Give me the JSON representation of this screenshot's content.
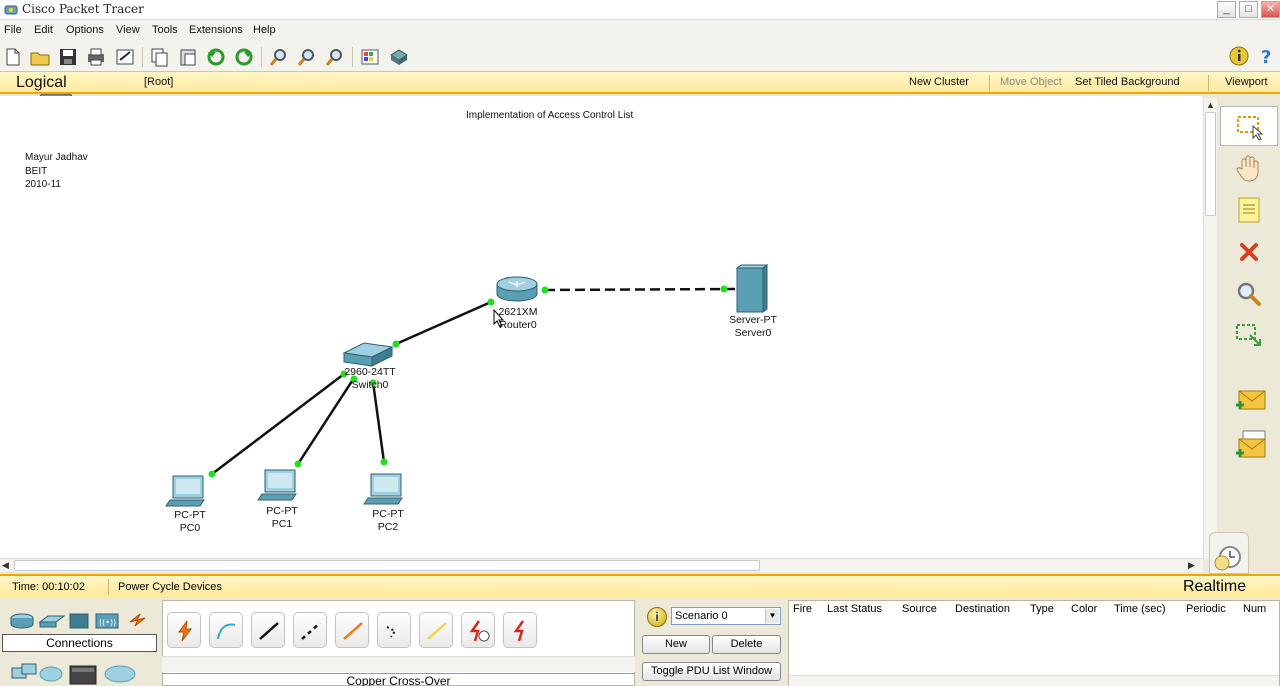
{
  "window": {
    "title": "Cisco Packet Tracer",
    "controls": [
      "_",
      "□",
      "✕"
    ]
  },
  "menu": [
    "File",
    "Edit",
    "Options",
    "View",
    "Tools",
    "Extensions",
    "Help"
  ],
  "nav": {
    "mode": "Logical",
    "root": "[Root]",
    "new_cluster": "New Cluster",
    "move_object": "Move Object",
    "set_tiled_background": "Set Tiled Background",
    "viewport": "Viewport"
  },
  "workspace": {
    "note_title": "Implementation of Access Control List",
    "author_lines": [
      "Mayur Jadhav",
      "BEIT",
      "2010-11"
    ],
    "devices": {
      "router": {
        "model": "2621XM",
        "name": "Router0"
      },
      "switch": {
        "model": "2960-24TT",
        "name": "Switch0"
      },
      "server": {
        "model": "Server-PT",
        "name": "Server0"
      },
      "pc0": {
        "model": "PC-PT",
        "name": "PC0"
      },
      "pc1": {
        "model": "PC-PT",
        "name": "PC1"
      },
      "pc2": {
        "model": "PC-PT",
        "name": "PC2"
      }
    }
  },
  "status": {
    "time": "Time: 00:10:02",
    "power_cycle": "Power Cycle Devices",
    "mode": "Realtime"
  },
  "bottom": {
    "category_label": "Connections",
    "selected_connection": "Copper Cross-Over",
    "scenario": {
      "selected": "Scenario 0"
    },
    "buttons": {
      "new": "New",
      "delete": "Delete",
      "toggle": "Toggle PDU List Window"
    },
    "pdu_columns": [
      "Fire",
      "Last Status",
      "Source",
      "Destination",
      "Type",
      "Color",
      "Time (sec)",
      "Periodic",
      "Num"
    ]
  },
  "colors": {
    "accent_orange": "#f0a500",
    "link_green": "#22dd22",
    "device_teal": "#5a9fb4"
  }
}
